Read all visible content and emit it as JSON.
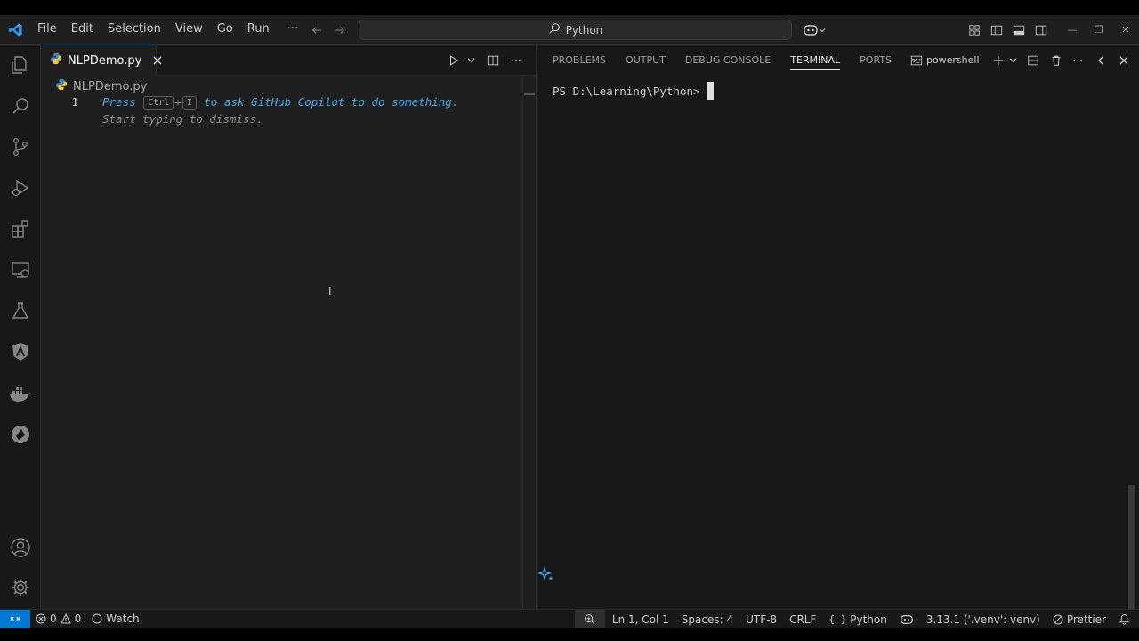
{
  "colors": {
    "accent": "#0078d4",
    "editor_bg": "#1f1f1f",
    "sidebar_bg": "#181818",
    "copilot_hint": "#4fa7e6"
  },
  "menu": [
    "File",
    "Edit",
    "Selection",
    "View",
    "Go",
    "Run"
  ],
  "menu_more": "···",
  "command_center": {
    "text": "Python"
  },
  "editor": {
    "tab_label": "NLPDemo.py",
    "breadcrumb": "NLPDemo.py",
    "line_number": "1",
    "hint": {
      "press": "Press",
      "key1": "Ctrl",
      "plus": "+",
      "key2": "I",
      "highlight": "to ask GitHub Copilot to do something.",
      "rest": " Start typing to dismiss."
    },
    "more": "···"
  },
  "panel": {
    "tabs": [
      "PROBLEMS",
      "OUTPUT",
      "DEBUG CONSOLE",
      "TERMINAL",
      "PORTS"
    ],
    "active_tab": "TERMINAL",
    "more": "···",
    "shell": "powershell",
    "actions_more": "···",
    "terminal_prompt": "PS D:\\Learning\\Python>"
  },
  "status": {
    "errors": "0",
    "warnings": "0",
    "watch": "Watch",
    "position": "Ln 1, Col 1",
    "spaces": "Spaces: 4",
    "encoding": "UTF-8",
    "eol": "CRLF",
    "language": "Python",
    "interpreter": "3.13.1 ('.venv': venv)",
    "formatter": "Prettier"
  },
  "icons": [
    "vscode-logo-icon",
    "explorer-icon",
    "search-icon",
    "source-control-icon",
    "run-debug-icon",
    "extensions-icon",
    "remote-explorer-icon",
    "testing-icon",
    "angular-icon",
    "docker-icon",
    "kite-icon",
    "account-icon",
    "settings-gear-icon",
    "copilot-icon",
    "bell-icon"
  ]
}
